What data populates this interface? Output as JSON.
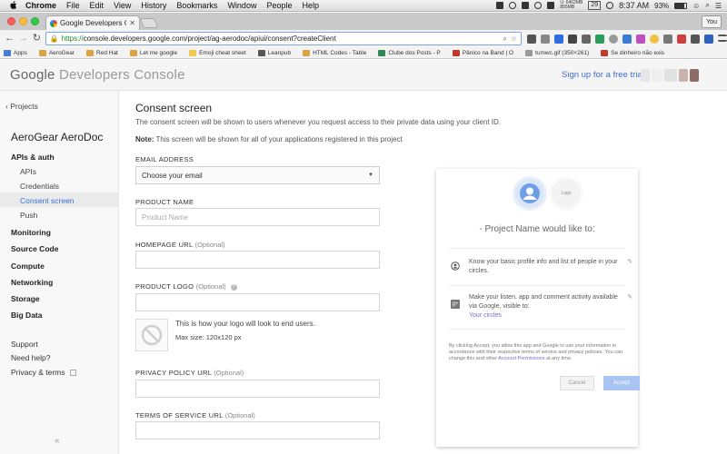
{
  "menubar": {
    "app": "Chrome",
    "items": [
      "File",
      "Edit",
      "View",
      "History",
      "Bookmarks",
      "Window",
      "People",
      "Help"
    ],
    "status_up": "U: 6462MB",
    "status_down": "855MB",
    "date_badge": "29",
    "time": "8:37 AM",
    "battery": "93%"
  },
  "browser": {
    "tab_title": "Google Developers Console",
    "profile_label": "You",
    "url_scheme": "https://",
    "url_rest": "console.developers.google.com/project/ag-aerodoc/apiui/consent?createClient"
  },
  "bookmarks": [
    {
      "label": "Apps",
      "color": "#4a7bd6"
    },
    {
      "label": "AeroGear",
      "color": "#d9a441"
    },
    {
      "label": "Red Hat",
      "color": "#d9a441"
    },
    {
      "label": "Let me google",
      "color": "#d9a441"
    },
    {
      "label": "Emoji cheat sheet",
      "color": "#f2c94c"
    },
    {
      "label": "Leanpub",
      "color": "#555555"
    },
    {
      "label": "HTML Codes - Table",
      "color": "#d9a441"
    },
    {
      "label": "Clube dos Posts - P",
      "color": "#2e8b57"
    },
    {
      "label": "Pânico na Band | O",
      "color": "#c0392b"
    },
    {
      "label": "tumwc.gif (350×261)",
      "color": "#999999"
    },
    {
      "label": "Se dinheiro não exis",
      "color": "#c0392b"
    }
  ],
  "header": {
    "brand_google": "Google",
    "brand_product": "Developers Console",
    "signup": "Sign up for a free trial."
  },
  "sidebar": {
    "projects": "Projects",
    "project_name": "AeroGear AeroDoc",
    "apis_auth": "APIs & auth",
    "apis": "APIs",
    "credentials": "Credentials",
    "consent_screen": "Consent screen",
    "push": "Push",
    "monitoring": "Monitoring",
    "source_code": "Source Code",
    "compute": "Compute",
    "networking": "Networking",
    "storage": "Storage",
    "big_data": "Big Data",
    "support": "Support",
    "need_help": "Need help?",
    "privacy_terms": "Privacy & terms",
    "collapse": "«"
  },
  "form": {
    "title": "Consent screen",
    "description": "The consent screen will be shown to users whenever you request access to their private data using your client ID.",
    "note_label": "Note:",
    "note_text": " This screen will be shown for all of your applications registered in this project",
    "email_label": "EMAIL ADDRESS",
    "email_value": "Choose your email",
    "product_name_label": "PRODUCT NAME",
    "product_name_placeholder": "Product Name",
    "homepage_label": "HOMEPAGE URL",
    "optional": "(Optional)",
    "product_logo_label": "PRODUCT LOGO",
    "logo_hint": "This is how your logo will look to end users.",
    "logo_size": "Max size: 120x120 px",
    "privacy_label": "PRIVACY POLICY URL",
    "terms_label": "TERMS OF SERVICE URL"
  },
  "preview": {
    "logo_text": "Logo",
    "title": "- Project Name would like to:",
    "perm1": "Know your basic profile info and list of people in your circles.",
    "perm2": "Make your listen, app and comment activity available via Google, visible to:",
    "perm2_link": "Your circles",
    "legal_text": "By clicking Accept, you allow this app and Google to use your information in accordance with their respective terms of service and privacy policies. You can change this and other ",
    "legal_link": "Account Permissions",
    "legal_tail": " at any time.",
    "cancel": "Cancel",
    "accept": "Accept"
  },
  "icons": {
    "help": "?",
    "edit": "pencil-icon"
  }
}
